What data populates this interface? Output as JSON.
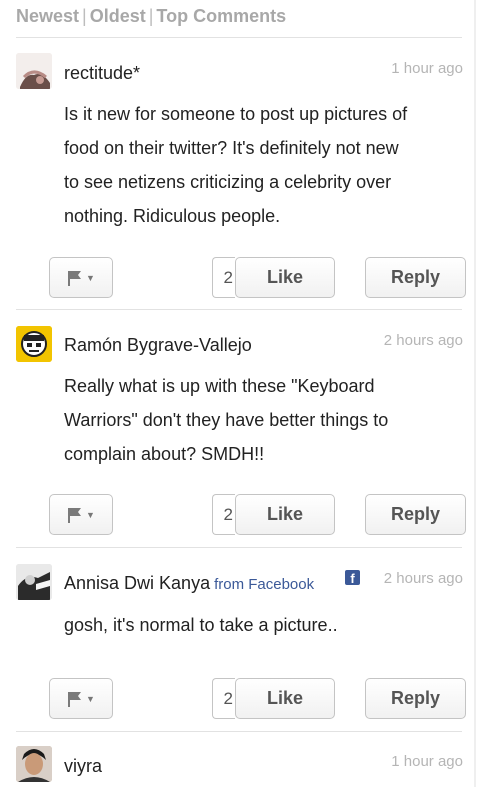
{
  "sort": {
    "newest": "Newest",
    "oldest": "Oldest",
    "top": "Top Comments",
    "sep": "|"
  },
  "comments": [
    {
      "author": "rectitude*",
      "time": "1 hour ago",
      "lines": [
        "Is it new for someone to post up pictures of",
        "food on their twitter?  It's definitely not new",
        "to see netizens criticizing a celebrity over",
        "nothing.  Ridiculous people."
      ],
      "likes": "2",
      "like_label": "Like",
      "reply_label": "Reply"
    },
    {
      "author": "Ramón Bygrave-Vallejo",
      "time": "2 hours ago",
      "lines": [
        "Really what is up with these \"Keyboard",
        "Warriors\"  don't they have better things to",
        "complain about?  SMDH!!"
      ],
      "likes": "2",
      "like_label": "Like",
      "reply_label": "Reply"
    },
    {
      "author": "Annisa Dwi Kanya",
      "via": "from Facebook",
      "fb_glyph": "f",
      "time": "2 hours ago",
      "lines": [
        "gosh, it's normal to take a picture.."
      ],
      "likes": "2",
      "like_label": "Like",
      "reply_label": "Reply"
    },
    {
      "author": "viyra",
      "time": "1 hour ago"
    }
  ],
  "icons": {
    "flag": "flag-icon",
    "caret": "chevron-down-icon",
    "caret_glyph": "▼"
  }
}
